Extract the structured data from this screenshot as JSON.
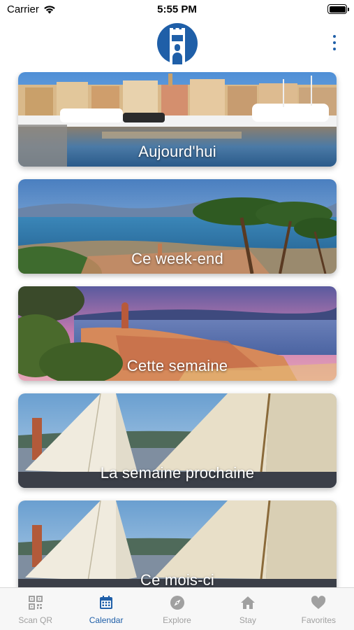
{
  "status_bar": {
    "carrier": "Carrier",
    "time": "5:55 PM"
  },
  "header": {
    "logo": "castle-tower-logo",
    "menu_icon": "more-vertical-icon"
  },
  "cards": [
    {
      "label": "Aujourd'hui",
      "scene": "harbor"
    },
    {
      "label": "Ce week-end",
      "scene": "bay-pine"
    },
    {
      "label": "Cette semaine",
      "scene": "sunset-town"
    },
    {
      "label": "La semaine prochaine",
      "scene": "sails"
    },
    {
      "label": "Ce mois-ci",
      "scene": "sails"
    }
  ],
  "tabs": [
    {
      "label": "Scan QR",
      "icon": "qr-code-icon",
      "active": false
    },
    {
      "label": "Calendar",
      "icon": "calendar-icon",
      "active": true
    },
    {
      "label": "Explore",
      "icon": "compass-icon",
      "active": false
    },
    {
      "label": "Stay",
      "icon": "house-icon",
      "active": false
    },
    {
      "label": "Favorites",
      "icon": "heart-icon",
      "active": false
    }
  ],
  "colors": {
    "accent": "#1f5fa8",
    "inactive": "#a0a0a0",
    "tab_bar_bg": "#f7f7f7"
  }
}
